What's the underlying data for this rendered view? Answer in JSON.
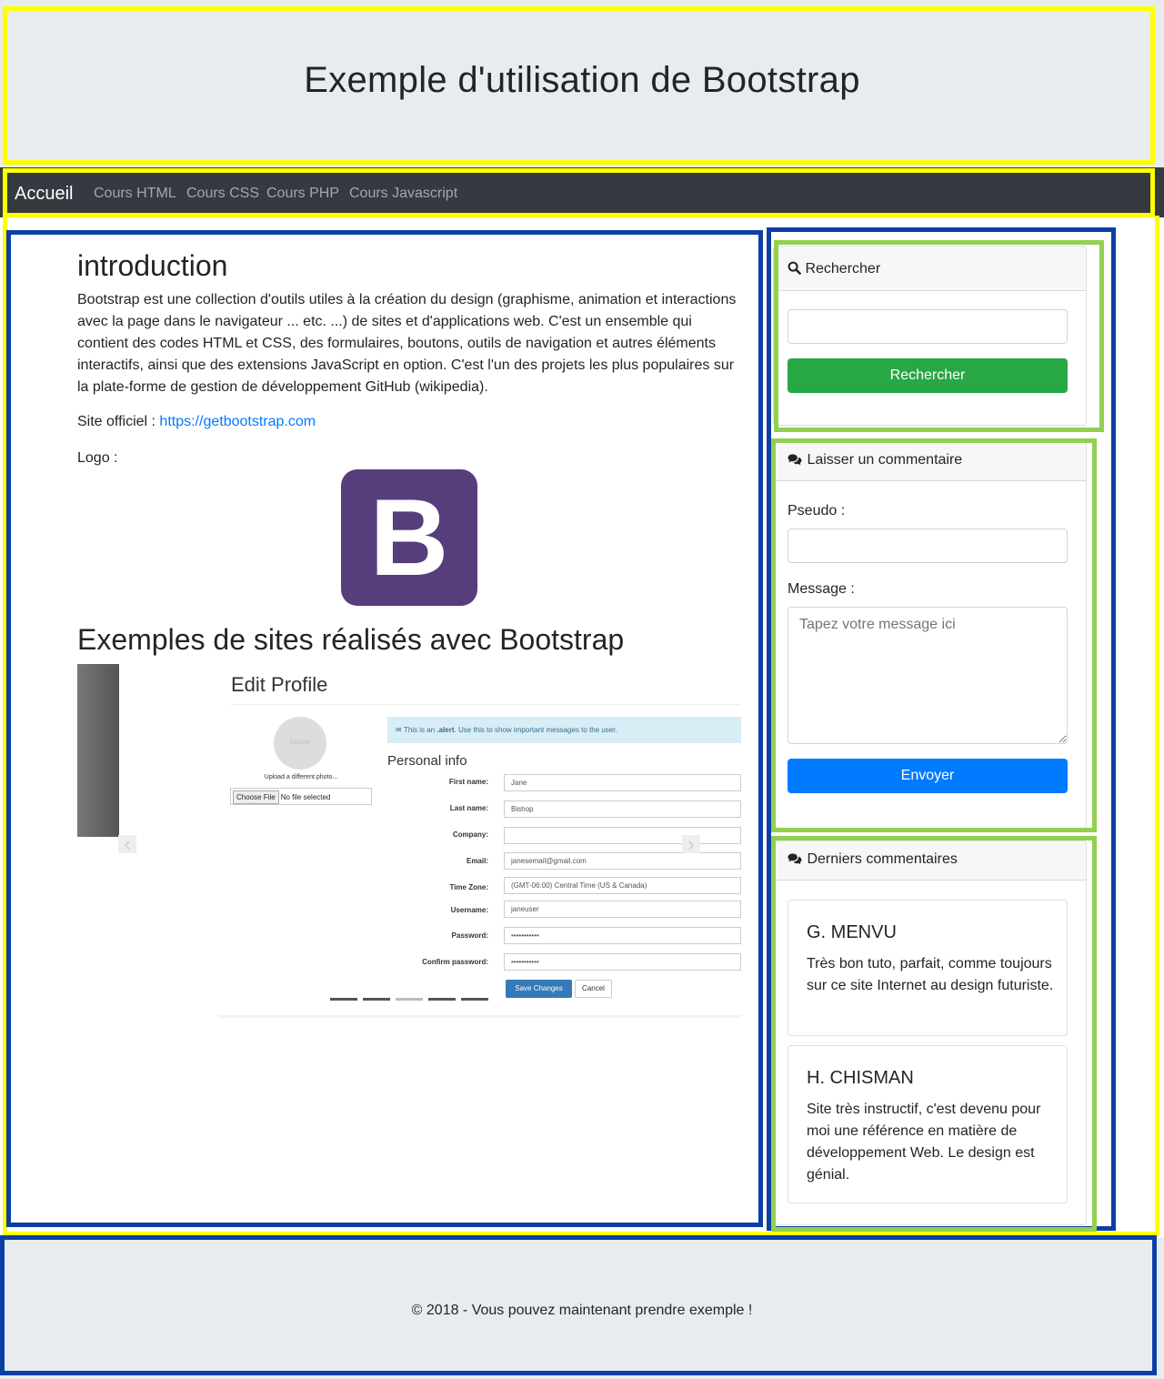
{
  "header": {
    "title": "Exemple d'utilisation de Bootstrap"
  },
  "navbar": {
    "brand": "Accueil",
    "links": [
      "Cours HTML",
      "Cours CSS",
      "Cours PHP",
      "Cours Javascript"
    ]
  },
  "main": {
    "intro_title": "introduction",
    "intro_text": "Bootstrap est une collection d'outils utiles à la création du design (graphisme, animation et interactions avec la page dans le navigateur ... etc. ...) de sites et d'applications web. C'est un ensemble qui contient des codes HTML et CSS, des formulaires, boutons, outils de navigation et autres éléments interactifs, ainsi que des extensions JavaScript en option. C'est l'un des projets les plus populaires sur la plate-forme de gestion de développement GitHub (wikipedia).",
    "site_label": "Site officiel : ",
    "site_url": "https://getbootstrap.com",
    "logo_label": "Logo :",
    "logo_letter": "B",
    "examples_title": "Exemples de sites réalisés avec Bootstrap",
    "carousel": {
      "prev_icon": "‹",
      "next_icon": "›",
      "slide": {
        "title": "Edit Profile",
        "avatar_text": "100x100",
        "upload_text": "Upload a different photo...",
        "file_button": "Choose File",
        "file_status": "No file selected",
        "alert_prefix": "This is an ",
        "alert_strong": ".alert",
        "alert_suffix": ". Use this to show important messages to the user.",
        "section": "Personal info",
        "fields": [
          {
            "label": "First name:",
            "value": "Jane"
          },
          {
            "label": "Last name:",
            "value": "Bishop"
          },
          {
            "label": "Company:",
            "value": ""
          },
          {
            "label": "Email:",
            "value": "janesemail@gmail.com"
          },
          {
            "label": "Time Zone:",
            "value": "(GMT-06:00) Central Time (US & Canada)"
          },
          {
            "label": "Username:",
            "value": "janeuser"
          },
          {
            "label": "Password:",
            "value": "•••••••••••"
          },
          {
            "label": "Confirm password:",
            "value": "•••••••••••"
          }
        ],
        "save_label": "Save Changes",
        "cancel_label": "Cancel"
      },
      "indicators": 5,
      "active_indicator": 3
    }
  },
  "sidebar": {
    "search": {
      "header": "Rechercher",
      "input_value": "",
      "button": "Rechercher"
    },
    "comment_form": {
      "header": "Laisser un commentaire",
      "pseudo_label": "Pseudo :",
      "pseudo_value": "",
      "message_label": "Message :",
      "message_placeholder": "Tapez votre message ici",
      "button": "Envoyer"
    },
    "recent": {
      "header": "Derniers commentaires",
      "comments": [
        {
          "author": "G. MENVU",
          "text": "Très bon tuto, parfait, comme toujours sur ce site Internet au design futuriste."
        },
        {
          "author": "H. CHISMAN",
          "text": "Site très instructif, c'est devenu pour moi une référence en matière de développement Web. Le design est génial."
        }
      ]
    }
  },
  "footer": {
    "text": "© 2018 - Vous pouvez maintenant prendre exemple !"
  },
  "colors": {
    "navbar": "#343a40",
    "jumbotron": "#e9ecef",
    "link": "#007bff",
    "success": "#28a745",
    "primary": "#007bff",
    "bootstrap_purple": "#563d7c",
    "annotation_yellow": "#ffff00",
    "annotation_blue": "#0b3fa6",
    "annotation_green": "#92d050"
  }
}
